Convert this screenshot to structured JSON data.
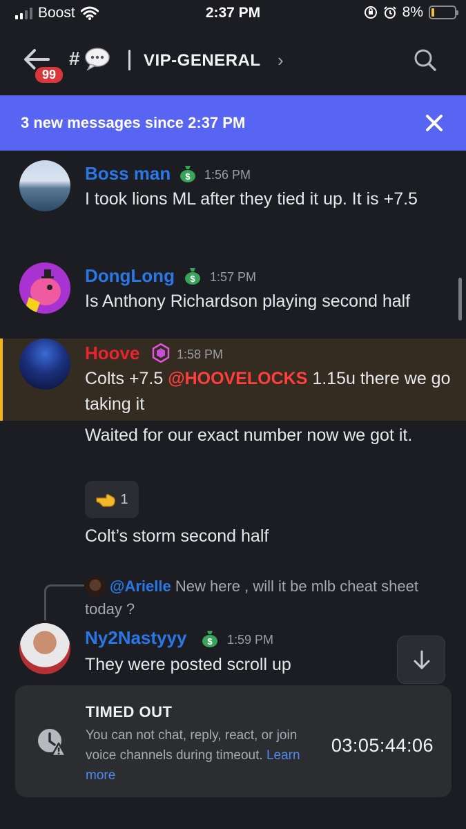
{
  "status_bar": {
    "carrier": "Boost",
    "time": "2:37 PM",
    "battery": "8%"
  },
  "header": {
    "unread_badge": "99",
    "channel_prefix": "#",
    "channel_name": "VIP-GENERAL",
    "chevron": "›"
  },
  "new_messages_bar": {
    "text": "3 new messages since 2:37 PM"
  },
  "messages": [
    {
      "author": "Boss man",
      "role_icon": "money-bag-icon",
      "time": "1:56 PM",
      "lines": [
        "I took lions ML after they tied it up. It is +7.5"
      ]
    },
    {
      "author": "DongLong",
      "role_icon": "money-bag-icon",
      "time": "1:57 PM",
      "lines": [
        "Is Anthony Richardson playing second half"
      ]
    },
    {
      "author": "Hoove",
      "role_icon": "hexagon-badge-icon",
      "time": "1:58 PM",
      "first_line_pre": "Colts +7.5 ",
      "mention": "@HOOVELOCKS",
      "first_line_post": " 1.15u there we go taking it",
      "follow_ups": [
        "Waited for our exact number now we got it.",
        "Colt’s storm second half"
      ],
      "reaction": {
        "emoji": "pointing-hand-emoji",
        "count": "1"
      }
    },
    {
      "author": "Ny2Nastyyy",
      "role_icon": "money-bag-icon",
      "time": "1:59 PM",
      "reply_to": {
        "user": "@Arielle",
        "text": "New here , will it be mlb cheat sheet today ?"
      },
      "lines": [
        "They were posted scroll up"
      ]
    }
  ],
  "timeout_card": {
    "title": "TIMED OUT",
    "description": "You can not chat, reply, react, or join voice channels during timeout.",
    "link": "Learn more",
    "countdown": "03:05:44:06"
  },
  "colors": {
    "blurple": "#5865f2",
    "mention_red": "#e8242e",
    "highlight_bar": "#f2b51c"
  }
}
